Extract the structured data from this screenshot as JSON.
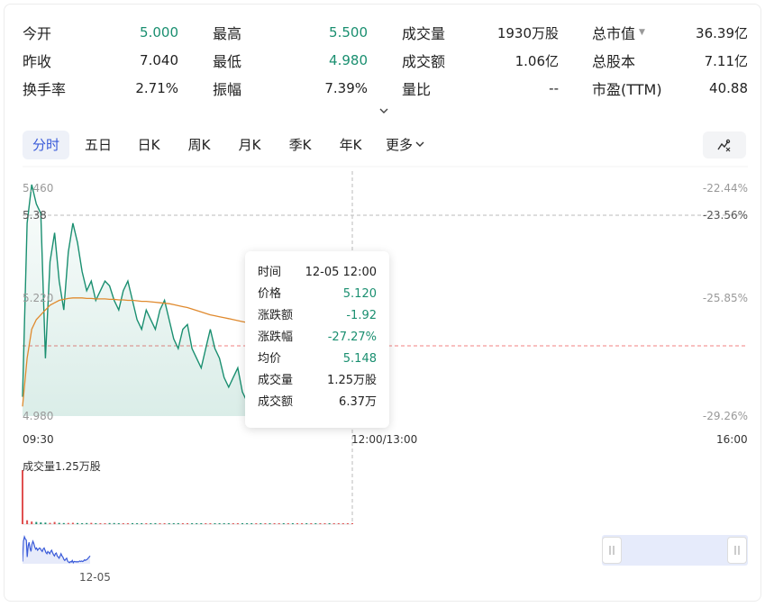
{
  "stats": {
    "rows": [
      [
        {
          "label": "今开",
          "value": "5.000",
          "green": true
        },
        {
          "label": "最高",
          "value": "5.500",
          "green": true
        },
        {
          "label": "成交量",
          "value": "1930万股",
          "green": false
        },
        {
          "label": "总市值",
          "value": "36.39亿",
          "green": false,
          "dropdown": true
        }
      ],
      [
        {
          "label": "昨收",
          "value": "7.040",
          "green": false
        },
        {
          "label": "最低",
          "value": "4.980",
          "green": true
        },
        {
          "label": "成交额",
          "value": "1.06亿",
          "green": false
        },
        {
          "label": "总股本",
          "value": "7.11亿",
          "green": false
        }
      ],
      [
        {
          "label": "换手率",
          "value": "2.71%",
          "green": false
        },
        {
          "label": "振幅",
          "value": "7.39%",
          "green": false
        },
        {
          "label": "量比",
          "value": "--",
          "green": false
        },
        {
          "label": "市盈(TTM)",
          "value": "40.88",
          "green": false
        }
      ]
    ]
  },
  "tabs": [
    {
      "label": "分时",
      "active": true
    },
    {
      "label": "五日"
    },
    {
      "label": "日K"
    },
    {
      "label": "周K"
    },
    {
      "label": "月K"
    },
    {
      "label": "季K"
    },
    {
      "label": "年K"
    },
    {
      "label": "更多"
    }
  ],
  "icons": {
    "expand": "chevron-down-icon",
    "tool": "draw-tool-icon",
    "more": "chevron-down-icon"
  },
  "chart": {
    "y_left": {
      "top": "5.460",
      "cross": "5.38",
      "mid": "5.220",
      "bottom": "4.980"
    },
    "y_right": {
      "top": "-22.44%",
      "cross": "-23.56%",
      "mid": "-25.85%",
      "bottom": "-29.26%"
    },
    "x_labels": {
      "start": "09:30",
      "mid": "12:00/13:00",
      "end": "16:00"
    },
    "volume_title": "成交量1.25万股",
    "mini_date": "12-05",
    "price_series": [
      5.02,
      5.38,
      5.46,
      5.42,
      5.4,
      5.1,
      5.3,
      5.36,
      5.26,
      5.2,
      5.32,
      5.38,
      5.34,
      5.28,
      5.24,
      5.26,
      5.22,
      5.24,
      5.26,
      5.25,
      5.22,
      5.2,
      5.24,
      5.26,
      5.22,
      5.18,
      5.16,
      5.2,
      5.18,
      5.16,
      5.2,
      5.22,
      5.18,
      5.14,
      5.12,
      5.16,
      5.17,
      5.12,
      5.1,
      5.08,
      5.12,
      5.16,
      5.12,
      5.1,
      5.06,
      5.04,
      5.06,
      5.08,
      5.03,
      5.01,
      5.0,
      5.02,
      5.01,
      5.04,
      5.0,
      5.02,
      5.02,
      5.01,
      5.02,
      5.01,
      5.02,
      5.03,
      5.02,
      5.03,
      5.02,
      5.03,
      5.05,
      5.04,
      5.05,
      5.06,
      5.08,
      5.1,
      5.12
    ],
    "avg_series": [
      5.0,
      5.1,
      5.16,
      5.18,
      5.19,
      5.2,
      5.21,
      5.215,
      5.22,
      5.222,
      5.224,
      5.225,
      5.225,
      5.225,
      5.224,
      5.224,
      5.223,
      5.223,
      5.223,
      5.222,
      5.222,
      5.221,
      5.221,
      5.22,
      5.22,
      5.219,
      5.218,
      5.218,
      5.217,
      5.216,
      5.215,
      5.214,
      5.213,
      5.211,
      5.209,
      5.207,
      5.205,
      5.202,
      5.199,
      5.196,
      5.193,
      5.19,
      5.188,
      5.186,
      5.184,
      5.182,
      5.18,
      5.178,
      5.176,
      5.174,
      5.172,
      5.17,
      5.168,
      5.166,
      5.165,
      5.164,
      5.162,
      5.16,
      5.159,
      5.158,
      5.157,
      5.156,
      5.155,
      5.154,
      5.153,
      5.152,
      5.151,
      5.15,
      5.15,
      5.149,
      5.149,
      5.148,
      5.148
    ],
    "volume_series": [
      12500,
      900,
      600,
      500,
      400,
      350,
      300,
      500,
      300,
      250,
      280,
      320,
      260,
      200,
      240,
      300,
      220,
      180,
      200,
      260,
      240,
      200,
      180,
      160,
      220,
      200,
      180,
      160,
      200,
      220,
      180,
      160,
      140,
      200,
      220,
      180,
      160,
      140,
      160,
      180,
      160,
      140,
      120,
      140,
      160,
      140,
      120,
      140,
      160,
      120,
      140,
      120,
      140,
      120,
      100,
      120,
      140,
      120,
      100,
      120,
      100,
      120,
      140,
      120,
      100,
      120,
      100,
      120,
      100,
      120,
      140,
      120,
      120
    ],
    "y_min": 4.98,
    "y_max": 5.46,
    "prev_close_ref": 5.148,
    "crosshair_price": 5.38
  },
  "tooltip": {
    "rows": [
      {
        "k": "时间",
        "v": "12-05 12:00",
        "green": false
      },
      {
        "k": "价格",
        "v": "5.120",
        "green": true
      },
      {
        "k": "涨跌额",
        "v": "-1.92",
        "green": true
      },
      {
        "k": "涨跌幅",
        "v": "-27.27%",
        "green": true
      },
      {
        "k": "均价",
        "v": "5.148",
        "green": true
      },
      {
        "k": "成交量",
        "v": "1.25万股",
        "green": false
      },
      {
        "k": "成交额",
        "v": "6.37万",
        "green": false
      }
    ]
  },
  "colors": {
    "price_line": "#1a8f70",
    "avg_line": "#e08a2e",
    "ref_line": "#f08080",
    "active_tab": "#3a5bd9",
    "mini_line": "#3a5bd9"
  }
}
